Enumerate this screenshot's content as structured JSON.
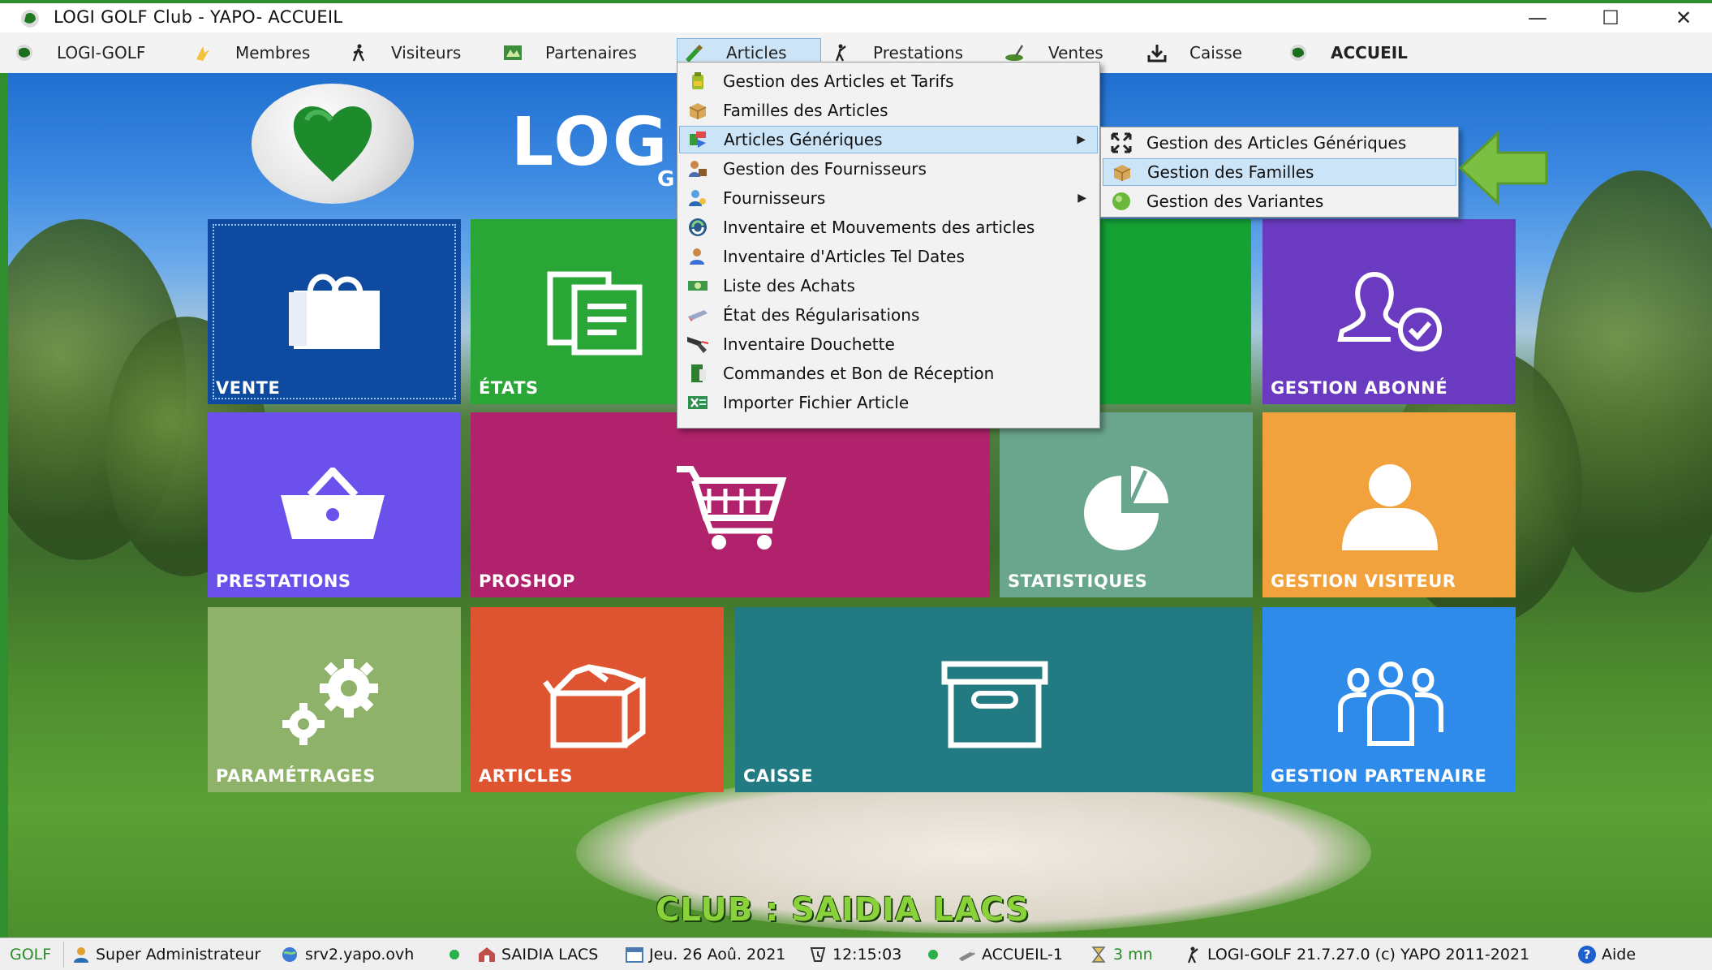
{
  "window": {
    "title": "LOGI GOLF Club - YAPO- ACCUEIL",
    "minimize": "—",
    "maximize": "☐",
    "close": "✕"
  },
  "menubar": {
    "items": [
      {
        "label": "LOGI-GOLF",
        "icon": "golf-ball-icon"
      },
      {
        "label": "Membres",
        "icon": "members-icon"
      },
      {
        "label": "Visiteurs",
        "icon": "walker-icon"
      },
      {
        "label": "Partenaires",
        "icon": "partners-icon"
      },
      {
        "label": "Articles",
        "icon": "articles-icon"
      },
      {
        "label": "Prestations",
        "icon": "golfer-icon"
      },
      {
        "label": "Ventes",
        "icon": "sales-icon"
      },
      {
        "label": "Caisse",
        "icon": "download-icon"
      },
      {
        "label": "ACCUEIL",
        "icon": "home-ball-icon"
      }
    ]
  },
  "logo": {
    "text": "LOG",
    "sub": "G"
  },
  "tiles": [
    {
      "label": "VENTE",
      "color": "#0d4aa0",
      "icon": "shopping-bag-icon"
    },
    {
      "label": "ÉTATS",
      "color": "#2aa637",
      "icon": "documents-icon"
    },
    {
      "label": "",
      "color": "#16a134",
      "icon": ""
    },
    {
      "label": "GESTION ABONNÉ",
      "color": "#6a3bc0",
      "icon": "user-check-icon"
    },
    {
      "label": "PRESTATIONS",
      "color": "#6b50ec",
      "icon": "basket-icon"
    },
    {
      "label": "PROSHOP",
      "color": "#b0226b",
      "icon": "cart-icon"
    },
    {
      "label": "STATISTIQUES",
      "color": "#6aa58e",
      "icon": "pie-chart-icon"
    },
    {
      "label": "GESTION VISITEUR",
      "color": "#f1a23d",
      "icon": "person-icon"
    },
    {
      "label": "PARAMÉTRAGES",
      "color": "#8eb26a",
      "icon": "gears-icon"
    },
    {
      "label": "ARTICLES",
      "color": "#de5430",
      "icon": "box-icon"
    },
    {
      "label": "CAISSE",
      "color": "#227a82",
      "icon": "archive-icon"
    },
    {
      "label": "GESTION PARTENAIRE",
      "color": "#2f8bea",
      "icon": "group-icon"
    }
  ],
  "articles_menu": {
    "items": [
      {
        "label": "Gestion des Articles et Tarifs",
        "icon": "tag-icon",
        "submenu": false
      },
      {
        "label": "Familles des Articles",
        "icon": "box-family-icon",
        "submenu": false
      },
      {
        "label": "Articles Génériques",
        "icon": "generic-articles-icon",
        "submenu": true
      },
      {
        "label": "Gestion des Fournisseurs",
        "icon": "supplier-icon",
        "submenu": false
      },
      {
        "label": "Fournisseurs",
        "icon": "suppliers-icon",
        "submenu": true
      },
      {
        "label": "Inventaire et Mouvements des articles",
        "icon": "inventory-cycle-icon",
        "submenu": false
      },
      {
        "label": "Inventaire d'Articles Tel Dates",
        "icon": "inventory-user-icon",
        "submenu": false
      },
      {
        "label": "Liste des Achats",
        "icon": "money-icon",
        "submenu": false
      },
      {
        "label": "État des Régularisations",
        "icon": "eraser-icon",
        "submenu": false
      },
      {
        "label": "Inventaire Douchette",
        "icon": "barcode-scanner-icon",
        "submenu": false
      },
      {
        "label": "Commandes et Bon de Réception",
        "icon": "order-book-icon",
        "submenu": false
      },
      {
        "label": "Importer Fichier Article",
        "icon": "excel-import-icon",
        "submenu": false
      }
    ],
    "arrow": "▶"
  },
  "generic_submenu": {
    "items": [
      {
        "label": "Gestion des Articles Génériques",
        "icon": "expand-arrows-icon"
      },
      {
        "label": "Gestion des Familles",
        "icon": "family-box-icon"
      },
      {
        "label": "Gestion des Variantes",
        "icon": "variants-ball-icon"
      }
    ]
  },
  "club_banner": "CLUB : SAIDIA LACS",
  "statusbar": {
    "app": "GOLF",
    "user": "Super Administrateur",
    "server": "srv2.yapo.ovh",
    "club": "SAIDIA LACS",
    "date": "Jeu. 26 Aoû. 2021",
    "time": "12:15:03",
    "station": "ACCUEIL-1",
    "idle": "3 mn",
    "version": "LOGI-GOLF 21.7.27.0  (c) YAPO 2011-2021",
    "help": "Aide"
  },
  "colors": {
    "highlight": "#cce4f7",
    "pointer_arrow": "#7bc043",
    "club_banner": "#8ad23a"
  }
}
